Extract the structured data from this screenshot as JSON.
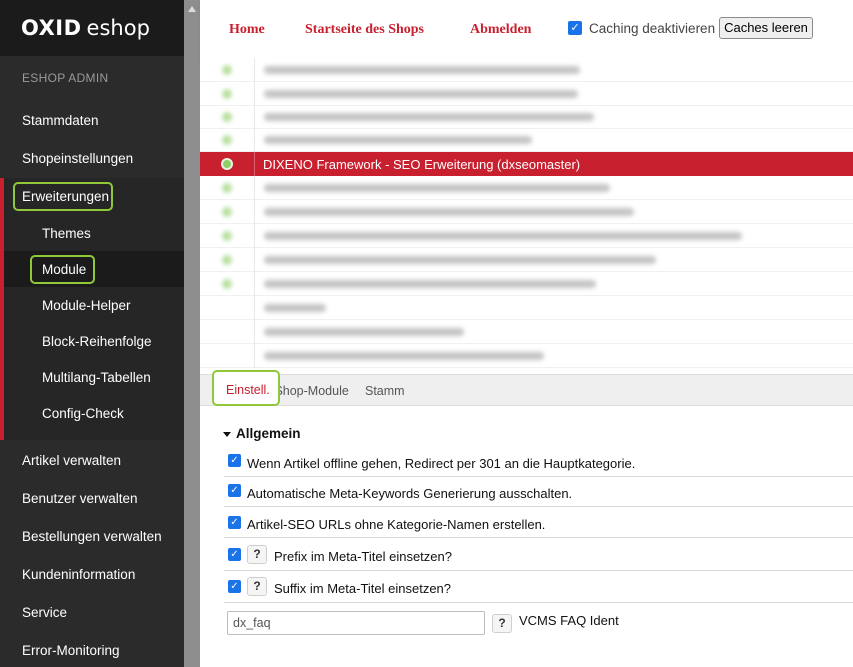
{
  "brand": {
    "name_bold": "OXID",
    "name_light": "eshop"
  },
  "sidebar": {
    "heading": "ESHOP ADMIN",
    "items": [
      {
        "label": "Stammdaten"
      },
      {
        "label": "Shopeinstellungen"
      },
      {
        "label": "Erweiterungen"
      },
      {
        "label": "Artikel verwalten"
      },
      {
        "label": "Benutzer verwalten"
      },
      {
        "label": "Bestellungen verwalten"
      },
      {
        "label": "Kundeninformation"
      },
      {
        "label": "Service"
      },
      {
        "label": "Error-Monitoring"
      }
    ],
    "sub_items": [
      {
        "label": "Themes"
      },
      {
        "label": "Module"
      },
      {
        "label": "Module-Helper"
      },
      {
        "label": "Block-Reihenfolge"
      },
      {
        "label": "Multilang-Tabellen"
      },
      {
        "label": "Config-Check"
      }
    ]
  },
  "header": {
    "links": [
      {
        "label": "Home"
      },
      {
        "label": "Startseite des Shops"
      },
      {
        "label": "Abmelden"
      }
    ],
    "caching_label": "Caching deaktivieren",
    "caching_checked": true,
    "clear_cache_label": "Caches leeren"
  },
  "module_list": {
    "selected": "DIXENO Framework - SEO Erweiterung (dxseomaster)"
  },
  "tabs": [
    {
      "label": "Installierte Shop-Module"
    },
    {
      "label": "Stamm"
    },
    {
      "label": "Einstell."
    }
  ],
  "settings": {
    "group_title": "Allgemein",
    "options": [
      {
        "label": "Wenn Artikel offline gehen, Redirect per 301 an die Hauptkategorie.",
        "checked": true
      },
      {
        "label": "Automatische Meta-Keywords Generierung ausschalten.",
        "checked": true
      },
      {
        "label": "Artikel-SEO URLs ohne Kategorie-Namen erstellen.",
        "checked": true
      },
      {
        "label": "Prefix im Meta-Titel einsetzen?",
        "checked": true
      },
      {
        "label": "Suffix im Meta-Titel einsetzen?",
        "checked": true
      }
    ],
    "help_symbol": "?",
    "faq_field": {
      "value": "dx_faq",
      "label": "VCMS FAQ Ident"
    }
  },
  "colors": {
    "accent": "#c8202f",
    "highlight": "#8fc93a",
    "checkbox": "#1a73e8"
  }
}
